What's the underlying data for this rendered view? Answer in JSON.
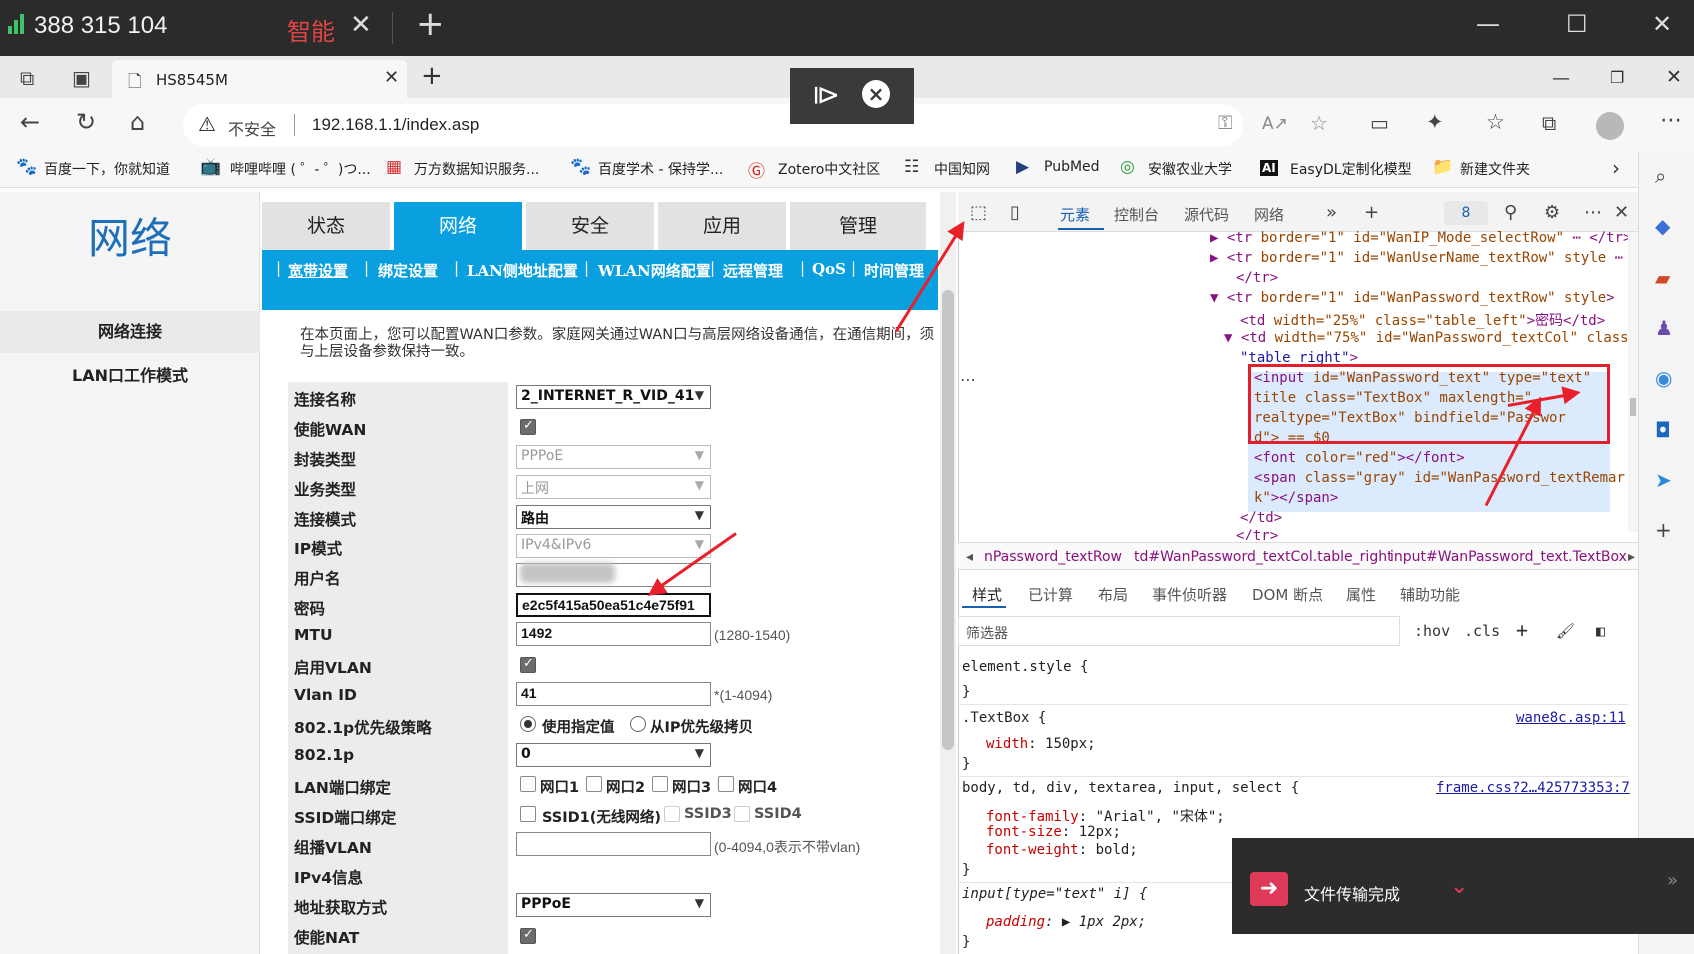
{
  "system_bar": {
    "phone": "388 315 104",
    "mode_label": "智能",
    "close_glyph": "✕",
    "plus_glyph": "+",
    "minimize_glyph": "—",
    "maximize_glyph": "☐",
    "close_window_glyph": "✕"
  },
  "browser": {
    "tab_title": "HS8545M",
    "tab_close": "✕",
    "new_tab": "+",
    "not_secure": "不安全",
    "url": "192.168.1.1/index.asp",
    "bookmarks": [
      {
        "icon": "🐾",
        "label": "百度一下，你就知道"
      },
      {
        "icon": "📺",
        "label": "哔哩哔哩 ( ゜- ゜)つ..."
      },
      {
        "icon": "▦",
        "label": "万方数据知识服务..."
      },
      {
        "icon": "🐾",
        "label": "百度学术 - 保持学..."
      },
      {
        "icon": "Ⓖ",
        "label": "Zotero中文社区"
      },
      {
        "icon": "☷",
        "label": "中国知网"
      },
      {
        "icon": "▶",
        "label": "PubMed"
      },
      {
        "icon": "◎",
        "label": "安徽农业大学"
      },
      {
        "icon": "AI",
        "label": "EasyDL定制化模型"
      },
      {
        "icon": "📁",
        "label": "新建文件夹"
      }
    ]
  },
  "router": {
    "section_title": "网络",
    "left_nav": [
      "网络连接",
      "LAN口工作模式"
    ],
    "main_tabs": [
      "状态",
      "网络",
      "安全",
      "应用",
      "管理"
    ],
    "active_tab": "网络",
    "sub_tabs": [
      "宽带设置",
      "绑定设置",
      "LAN侧地址配置",
      "WLAN网络配置",
      "远程管理",
      "QoS",
      "时间管理"
    ],
    "intro": "在本页面上，您可以配置WAN口参数。家庭网关通过WAN口与高层网络设备通信，在通信期间，须与上层设备参数保持一致。",
    "fields": {
      "conn_name": {
        "label": "连接名称",
        "value": "2_INTERNET_R_VID_41"
      },
      "enable_wan": {
        "label": "使能WAN"
      },
      "encap": {
        "label": "封装类型",
        "value": "PPPoE"
      },
      "service": {
        "label": "业务类型",
        "value": "上网"
      },
      "conn_mode": {
        "label": "连接模式",
        "value": "路由"
      },
      "ip_mode": {
        "label": "IP模式",
        "value": "IPv4&IPv6"
      },
      "username": {
        "label": "用户名"
      },
      "password": {
        "label": "密码",
        "value": "e2c5f415a50ea51c4e75f91"
      },
      "mtu": {
        "label": "MTU",
        "value": "1492",
        "hint": "(1280-1540)"
      },
      "enable_vlan": {
        "label": "启用VLAN"
      },
      "vlan_id": {
        "label": "Vlan ID",
        "value": "41",
        "hint": "*(1-4094)"
      },
      "prio_policy": {
        "label": "802.1p优先级策略",
        "opt1": "使用指定值",
        "opt2": "从IP优先级拷贝"
      },
      "p8021": {
        "label": "802.1p",
        "value": "0"
      },
      "lan_bind": {
        "label": "LAN端口绑定",
        "opts": [
          "网口1",
          "网口2",
          "网口3",
          "网口4"
        ]
      },
      "ssid_bind": {
        "label": "SSID端口绑定",
        "opts": [
          "SSID1(无线网络)",
          "SSID3",
          "SSID4"
        ]
      },
      "mcast_vlan": {
        "label": "组播VLAN",
        "hint": "(0-4094,0表示不带vlan)"
      },
      "ipv4_info": {
        "label": "IPv4信息"
      },
      "addr_mode": {
        "label": "地址获取方式",
        "value": "PPPoE"
      },
      "enable_nat": {
        "label": "使能NAT"
      }
    }
  },
  "devtools": {
    "tabs": [
      "元素",
      "控制台",
      "源代码",
      "网络"
    ],
    "issues": "8",
    "dom_lines": [
      {
        "open": "▶",
        "tag": "<tr ",
        "attrs": "border=\"1\" id=\"WanIP_Mode_selectRow\"",
        "tail": " ⋯ </tr>"
      },
      {
        "open": "▶",
        "tag": "<tr ",
        "attrs": "border=\"1\" id=\"WanUserName_textRow\" style",
        "tail": " ⋯"
      },
      {
        "open": "",
        "tag": "</tr>",
        "attrs": "",
        "tail": ""
      },
      {
        "open": "▼",
        "tag": "<tr ",
        "attrs": "border=\"1\" id=\"WanPassword_textRow\" style",
        "tail": ">"
      },
      {
        "open": "",
        "tag": "<td ",
        "attrs": "width=\"25%\" class=\"table_left\"",
        "tail": ">密码</td>"
      },
      {
        "open": "▼",
        "tag": "<td ",
        "attrs": "width=\"75%\" id=\"WanPassword_textCol\" class=",
        "tail": ""
      },
      {
        "open": "",
        "tag": "",
        "attrs": "\"table_right\"",
        "tail": ">"
      },
      {
        "open": "",
        "tag": "<input ",
        "attrs": "id=\"WanPassword_text\" type=\"text\"",
        "tail": ""
      },
      {
        "open": "",
        "tag": "",
        "attrs": "title class=\"TextBox\" maxlength=\"",
        "tail": ""
      },
      {
        "open": "",
        "tag": "",
        "attrs": "realtype=\"TextBox\" bindfield=\"Passwor",
        "tail": ""
      },
      {
        "open": "",
        "tag": "",
        "attrs": "d\"> == $0",
        "tail": ""
      },
      {
        "open": "",
        "tag": "<font ",
        "attrs": "color=\"red\"",
        "tail": "></font>"
      },
      {
        "open": "",
        "tag": "<span ",
        "attrs": "class=\"gray\" id=\"WanPassword_textRemar",
        "tail": ""
      },
      {
        "open": "",
        "tag": "",
        "attrs": "k\"",
        "tail": "></span>"
      },
      {
        "open": "",
        "tag": "</td>",
        "attrs": "",
        "tail": ""
      },
      {
        "open": "",
        "tag": "</tr>",
        "attrs": "",
        "tail": ""
      }
    ],
    "breadcrumbs": [
      "nPassword_textRow",
      "td#WanPassword_textCol.table_right",
      "input#WanPassword_text.TextBox"
    ],
    "style_tabs": [
      "样式",
      "已计算",
      "布局",
      "事件侦听器",
      "DOM 断点",
      "属性",
      "辅助功能"
    ],
    "filter_placeholder": "筛选器",
    "hov": ":hov",
    "cls": ".cls",
    "css_rules": {
      "r1_sel": "element.style {",
      "close": "}",
      "r2_sel": ".TextBox {",
      "r2_src": "wane8c.asp:11",
      "r2_p1": "width",
      "r2_v1": " 150px;",
      "r3_sel": "body, td, div, textarea, input, select {",
      "r3_src": "frame.css?2…425773353:7",
      "r3_p1": "font-family",
      "r3_v1": " \"Arial\", \"宋体\";",
      "r3_p2": "font-size",
      "r3_v2": " 12px;",
      "r3_p3": "font-weight",
      "r3_v3": " bold;",
      "r4_sel": "input[type=\"text\" i] {",
      "r4_p1": "padding",
      "r4_v1": " ▶ 1px 2px;"
    }
  },
  "toast": {
    "text": "文件传输完成"
  },
  "colors": {
    "accent": "#0aa0df",
    "annotation_red": "#e8202a",
    "title_blue": "#1e6fb9"
  }
}
